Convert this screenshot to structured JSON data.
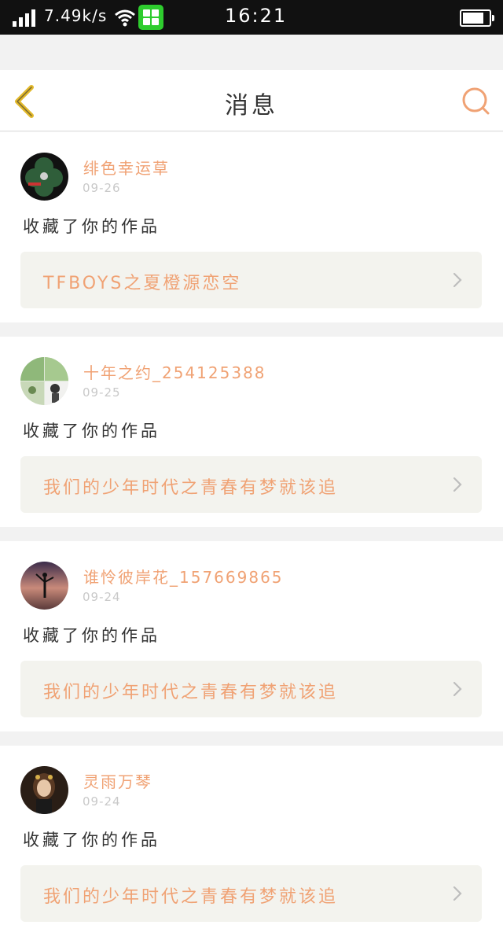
{
  "status_bar": {
    "speed": "7.49k/s",
    "time": "16:21",
    "battery_level": 0.8,
    "icons": [
      "signal-icon",
      "wifi-icon",
      "app-notification-icon",
      "battery-icon"
    ]
  },
  "header": {
    "title": "消息",
    "icons": [
      "back-chevron-icon",
      "search-icon"
    ]
  },
  "colors": {
    "accent": "#f0a274",
    "back_icon": "#e2b82a",
    "link_bg": "#f3f3ee",
    "text": "#333333",
    "date": "#c9c9c9"
  },
  "messages": [
    {
      "username": "绯色幸运草",
      "date": "09-26",
      "action": "收藏了你的作品",
      "work_title": "TFBOYS之夏橙源恋空"
    },
    {
      "username": "十年之约_254125388",
      "date": "09-25",
      "action": "收藏了你的作品",
      "work_title": "我们的少年时代之青春有梦就该追"
    },
    {
      "username": "谁怜彼岸花_157669865",
      "date": "09-24",
      "action": "收藏了你的作品",
      "work_title": "我们的少年时代之青春有梦就该追"
    },
    {
      "username": "灵雨万琴",
      "date": "09-24",
      "action": "收藏了你的作品",
      "work_title": "我们的少年时代之青春有梦就该追"
    }
  ]
}
